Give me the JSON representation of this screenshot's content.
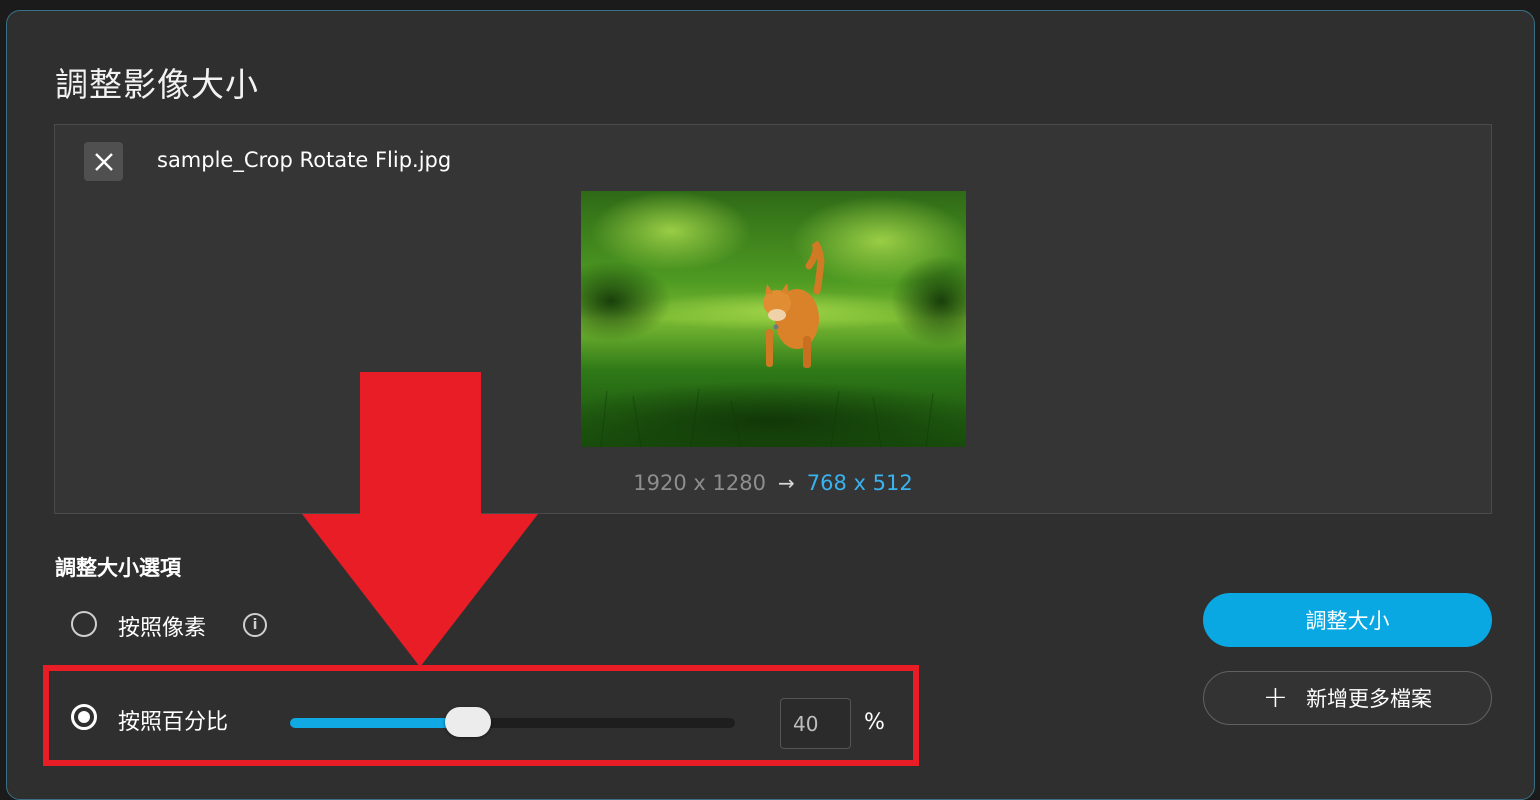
{
  "dialog": {
    "title": "調整影像大小"
  },
  "file": {
    "name": "sample_Crop Rotate Flip.jpg",
    "original_size": "1920 x 1280",
    "new_size": "768 x 512",
    "arrow_icon": "arrow-right-icon",
    "thumbnail": "orange cat walking on green grass"
  },
  "options": {
    "section_title": "調整大小選項",
    "by_pixels_label": "按照像素",
    "by_percent_label": "按照百分比",
    "selected": "by_percent",
    "percent_value": "40",
    "percent_sign": "%",
    "slider_fraction": 0.4
  },
  "actions": {
    "resize_label": "調整大小",
    "add_files_label": "新增更多檔案"
  },
  "colors": {
    "accent": "#0aa8e2",
    "new_size_text": "#3ab2ef",
    "highlight": "#e81d25"
  }
}
